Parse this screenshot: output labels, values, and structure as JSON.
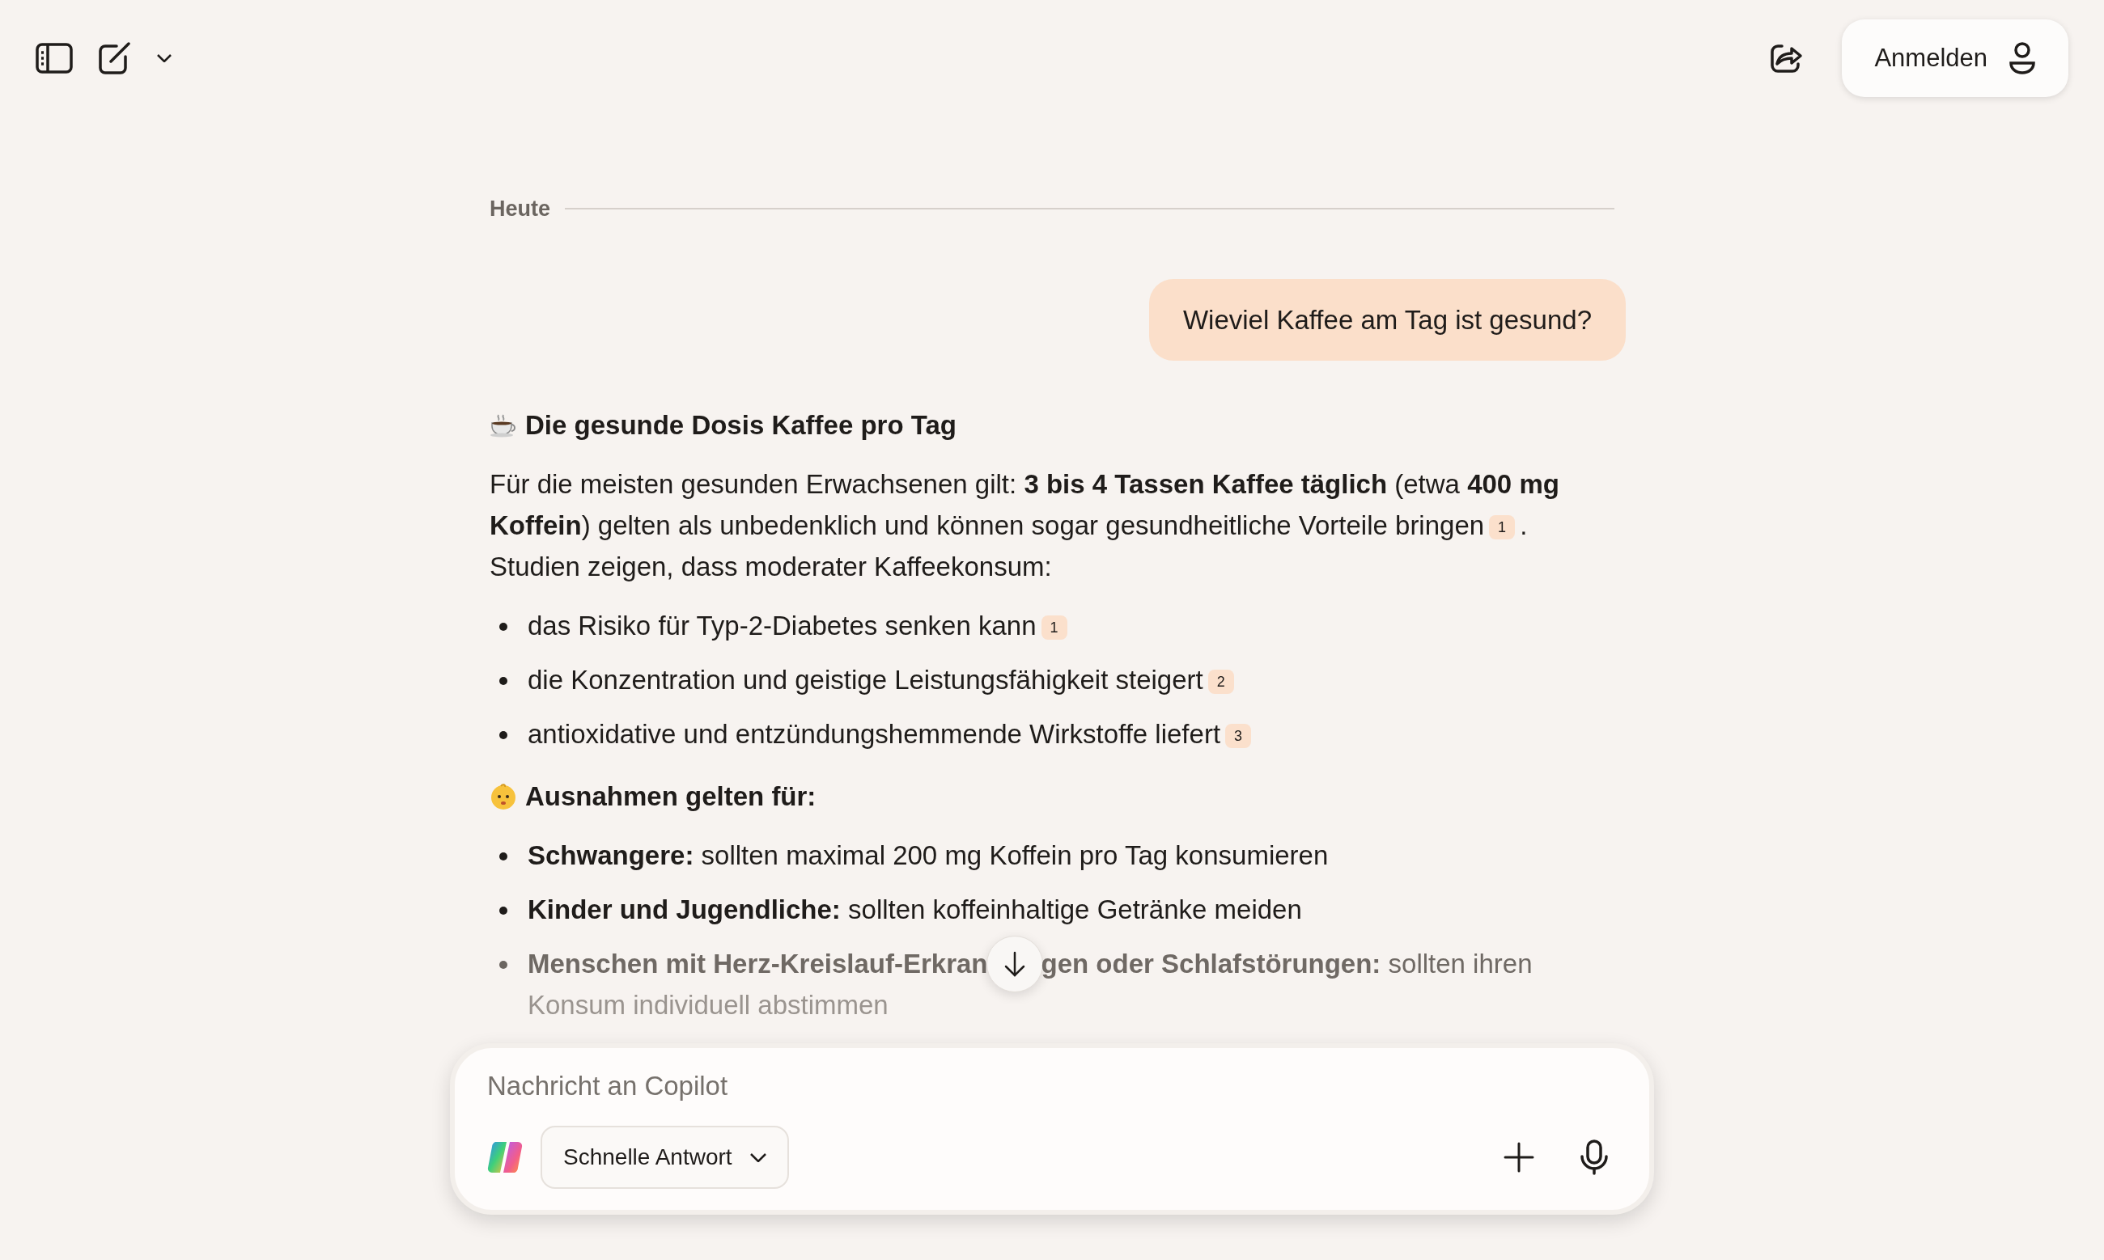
{
  "top_bar": {
    "account_button": "Anmelden"
  },
  "date_divider": "Heute",
  "user_message": "Wieviel Kaffee am Tag ist gesund?",
  "response": [
    {
      "kind": "heading",
      "text": "Die gesunde Dosis Kaffee pro Tag"
    },
    {
      "kind": "paragraph",
      "parts": [
        {
          "kind": "text",
          "text": "Für die meisten gesunden Erwachsenen gilt: **3 bis 4 Tassen Kaffee täglich** (etwa **400 mg Koffein**) gelten als unbedenklich und können sogar gesundheitliche Vorteile bringen"
        },
        {
          "kind": "citation",
          "text": "1"
        },
        {
          "kind": "text",
          "text": ". Studien zeigen, dass moderater Kaffeekonsum:"
        }
      ]
    },
    {
      "kind": "list",
      "items": [
        {
          "text": "das Risiko für Typ-2-Diabetes senken kann",
          "citation": "1"
        },
        {
          "text": "die Konzentration und geistige Leistungsfähigkeit steigert",
          "citation": "2"
        },
        {
          "text": "antioxidative und entzündungshemmende Wirkstoffe liefert",
          "citation": "3"
        }
      ]
    },
    {
      "kind": "heading",
      "text": "Ausnahmen gelten für:"
    },
    {
      "kind": "list",
      "items": [
        {
          "text": "**Schwangere:** sollten maximal 200 mg Koffein pro Tag konsumieren"
        },
        {
          "text": "**Kinder und Jugendliche:** sollten koffeinhaltige Getränke meiden"
        },
        {
          "text": "**Menschen mit Herz-Kreislauf-Erkran**",
          "text_after": "**gen oder Schlafstörungen:** sollten ihren",
          "text_continued": "Konsum individuell abstimmen"
        }
      ]
    }
  ],
  "composer": {
    "placeholder": "Nachricht an Copilot",
    "mode": "Schnelle Antwort"
  }
}
